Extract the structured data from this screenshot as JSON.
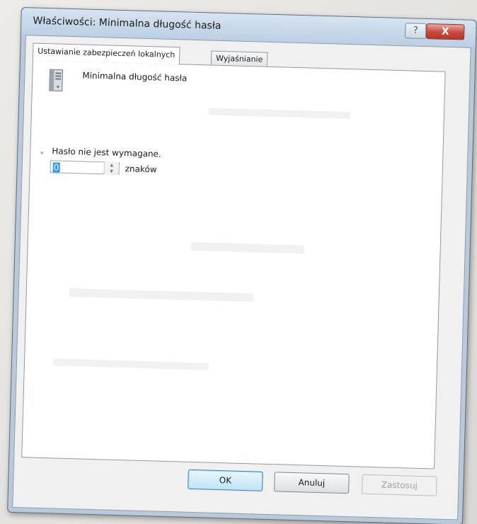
{
  "window": {
    "title": "Właściwości: Minimalna długość hasła",
    "help_glyph": "?",
    "close_glyph": "X"
  },
  "tabs": [
    {
      "label": "Ustawianie zabezpieczeń lokalnych",
      "active": true
    },
    {
      "label": "Wyjaśnianie",
      "active": false
    }
  ],
  "policy": {
    "icon": "server-icon",
    "name": "Minimalna długość hasła"
  },
  "setting": {
    "radio_label": "Hasło nie jest wymagane.",
    "value": "0",
    "unit": "znaków"
  },
  "buttons": {
    "ok": "OK",
    "cancel": "Anuluj",
    "apply": "Zastosuj"
  },
  "colors": {
    "title_bar": "#bccfe4",
    "close_button": "#c7483b",
    "selection": "#3399ff",
    "default_button_border": "#3c7fb1"
  }
}
